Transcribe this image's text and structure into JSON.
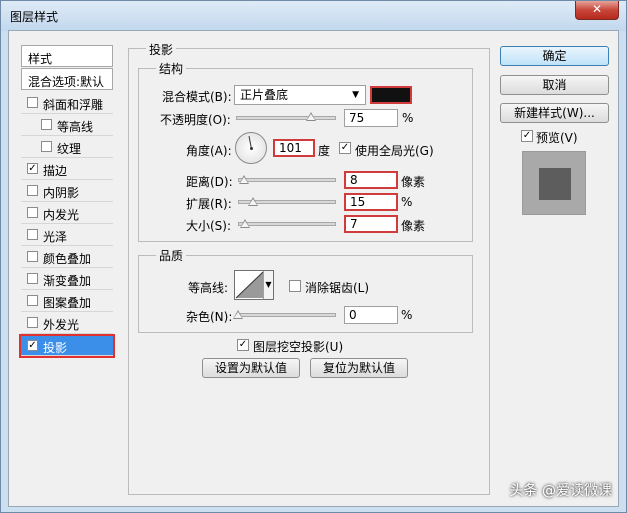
{
  "window": {
    "title": "图层样式",
    "close_glyph": "✕"
  },
  "left_list": {
    "header1": "样式",
    "header2": "混合选项:默认",
    "items": [
      {
        "label": "斜面和浮雕",
        "checked": false
      },
      {
        "label": "等高线",
        "checked": false
      },
      {
        "label": "纹理",
        "checked": false
      },
      {
        "label": "描边",
        "checked": true
      },
      {
        "label": "内阴影",
        "checked": false
      },
      {
        "label": "内发光",
        "checked": false
      },
      {
        "label": "光泽",
        "checked": false
      },
      {
        "label": "颜色叠加",
        "checked": false
      },
      {
        "label": "渐变叠加",
        "checked": false
      },
      {
        "label": "图案叠加",
        "checked": false
      },
      {
        "label": "外发光",
        "checked": false
      },
      {
        "label": "投影",
        "checked": true
      }
    ]
  },
  "drop_shadow": {
    "section_title": "投影",
    "structure_title": "结构",
    "blend_mode_label": "混合模式(B):",
    "blend_mode_value": "正片叠底",
    "shadow_color": "#111111",
    "opacity_label": "不透明度(O):",
    "opacity_value": "75",
    "opacity_unit": "%",
    "angle_label": "角度(A):",
    "angle_value": "101",
    "angle_unit": "度",
    "global_light_label": "使用全局光(G)",
    "global_light_checked": true,
    "distance_label": "距离(D):",
    "distance_value": "8",
    "distance_unit": "像素",
    "spread_label": "扩展(R):",
    "spread_value": "15",
    "spread_unit": "%",
    "size_label": "大小(S):",
    "size_value": "7",
    "size_unit": "像素",
    "quality_title": "品质",
    "contour_label": "等高线:",
    "antialias_label": "消除锯齿(L)",
    "antialias_checked": false,
    "noise_label": "杂色(N):",
    "noise_value": "0",
    "noise_unit": "%",
    "knockout_label": "图层挖空投影(U)",
    "knockout_checked": true,
    "set_default_label": "设置为默认值",
    "reset_default_label": "复位为默认值"
  },
  "right_panel": {
    "ok_label": "确定",
    "cancel_label": "取消",
    "new_style_label": "新建样式(W)...",
    "preview_label": "预览(V)",
    "preview_checked": true
  },
  "watermark": "头条 @爱读微课",
  "check_glyph": "✓"
}
